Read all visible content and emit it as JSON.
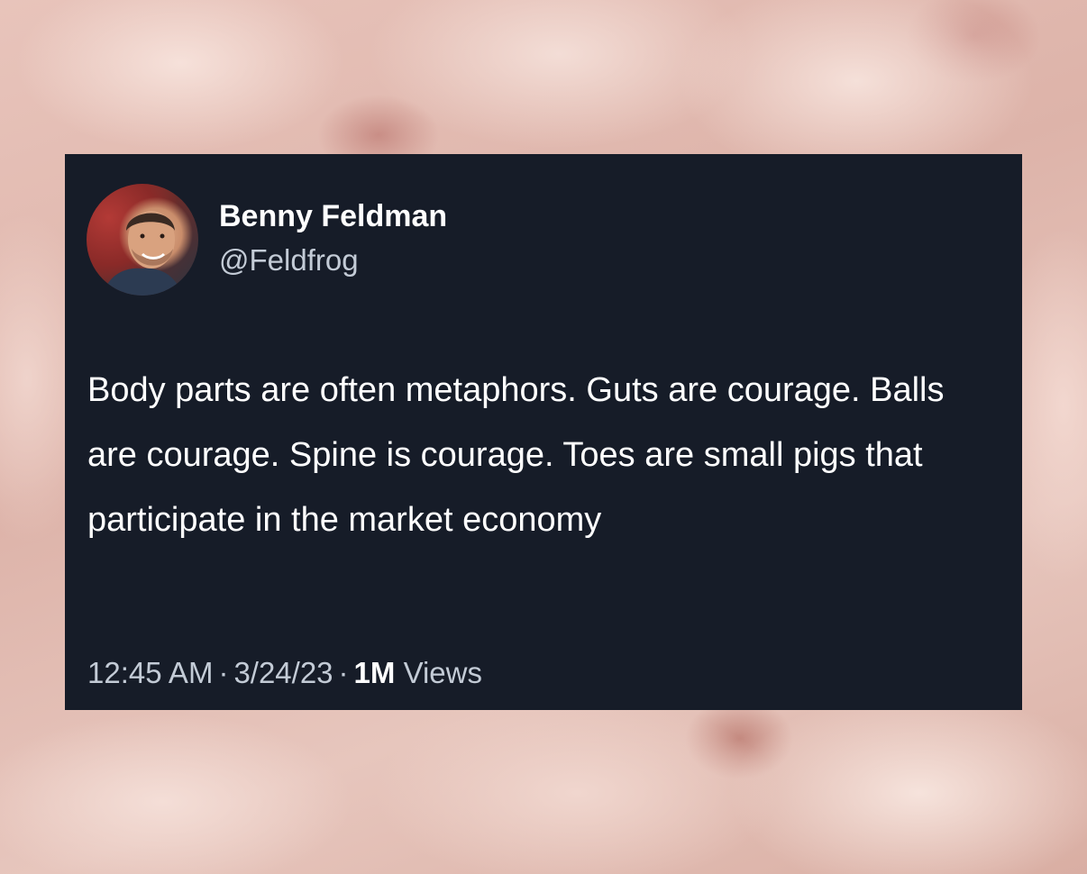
{
  "tweet": {
    "display_name": "Benny Feldman",
    "handle": "@Feldfrog",
    "text": "Body parts are often metaphors. Guts are courage. Balls are courage. Spine is courage. Toes are small pigs that participate in the market economy",
    "time": "12:45 AM",
    "separator": "·",
    "date": "3/24/23",
    "views_count": "1M",
    "views_label": "Views"
  },
  "colors": {
    "card_background": "#161c28",
    "primary_text": "#ffffff",
    "secondary_text": "#c3cbd6"
  },
  "icons": {
    "avatar": "profile-photo"
  }
}
